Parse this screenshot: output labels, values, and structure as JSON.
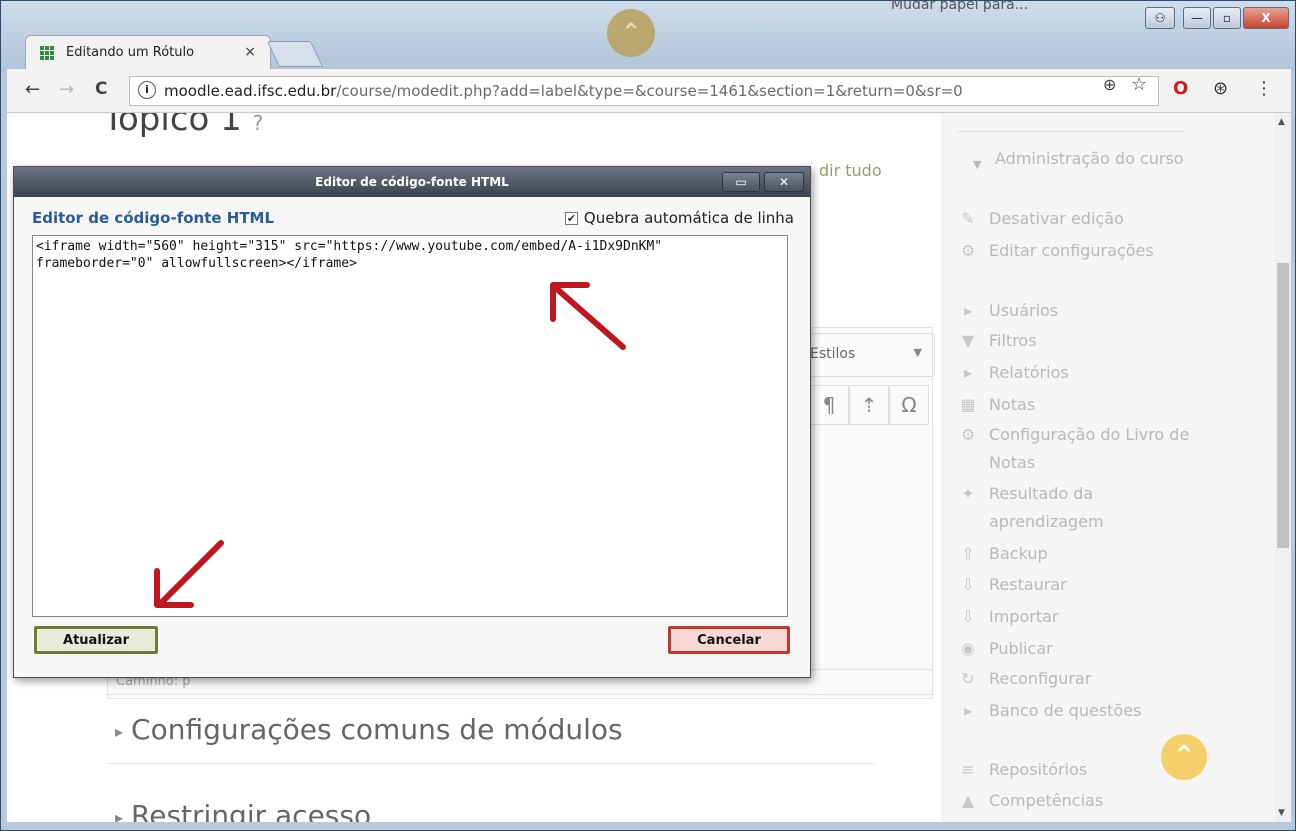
{
  "browser": {
    "tab_title": "Editando um Rótulo",
    "tab_close": "×",
    "url_host": "moodle.ead.ifsc.edu.br",
    "url_path": "/course/modedit.php?add=label&type=&course=1461&section=1&return=0&sr=0",
    "info_glyph": "i",
    "back": "←",
    "forward": "→",
    "reload": "C",
    "zoom_icon": "⊕",
    "star_icon": "☆",
    "opera_icon": "O",
    "ext_icon": "⊛",
    "menu_icon": "⋮",
    "win_min": "—",
    "win_max": "▫",
    "win_close": "X",
    "win_user": "⚇"
  },
  "top_banner_partial": "Mudar papel para...",
  "page": {
    "heading": "Tópico 1",
    "expand_all_partial": "dir tudo",
    "styles_label": "Estilos",
    "path_label": "Caminho: p",
    "section_common": "Configurações comuns de módulos",
    "section_restrict": "Restringir acesso"
  },
  "sidebar": {
    "header": "Administração do curso",
    "items": [
      {
        "icon": "✎",
        "label": "Desativar edição"
      },
      {
        "icon": "⚙",
        "label": "Editar configurações"
      },
      {
        "icon": "▸",
        "label": "Usuários"
      },
      {
        "icon": "▼",
        "label": "Filtros"
      },
      {
        "icon": "▸",
        "label": "Relatórios"
      },
      {
        "icon": "▦",
        "label": "Notas"
      },
      {
        "icon": "⚙",
        "label": "Configuração do Livro de Notas"
      },
      {
        "icon": "✦",
        "label": "Resultado da aprendizagem"
      },
      {
        "icon": "⇧",
        "label": "Backup"
      },
      {
        "icon": "⇩",
        "label": "Restaurar"
      },
      {
        "icon": "⇩",
        "label": "Importar"
      },
      {
        "icon": "◉",
        "label": "Publicar"
      },
      {
        "icon": "↻",
        "label": "Reconfigurar"
      },
      {
        "icon": "▸",
        "label": "Banco de questões"
      },
      {
        "icon": "≡",
        "label": "Repositórios"
      },
      {
        "icon": "▲",
        "label": "Competências"
      }
    ]
  },
  "modal": {
    "window_title": "Editor de código-fonte HTML",
    "title": "Editor de código-fonte HTML",
    "wrap_label": "Quebra automática de linha",
    "wrap_checked": "✔",
    "code": "<iframe width=\"560\" height=\"315\" src=\"https://www.youtube.com/embed/A-i1Dx9DnKM\" frameborder=\"0\" allowfullscreen></iframe>",
    "btn_update": "Atualizar",
    "btn_cancel": "Cancelar",
    "btn_max": "▭",
    "btn_close": "✕"
  },
  "colors": {
    "arrow": "#c0161e",
    "modal_title": "#2b5c9a",
    "update_border": "#6e7d35",
    "cancel_border": "#c23a2c",
    "scroll_top": "#f4cf6a"
  }
}
